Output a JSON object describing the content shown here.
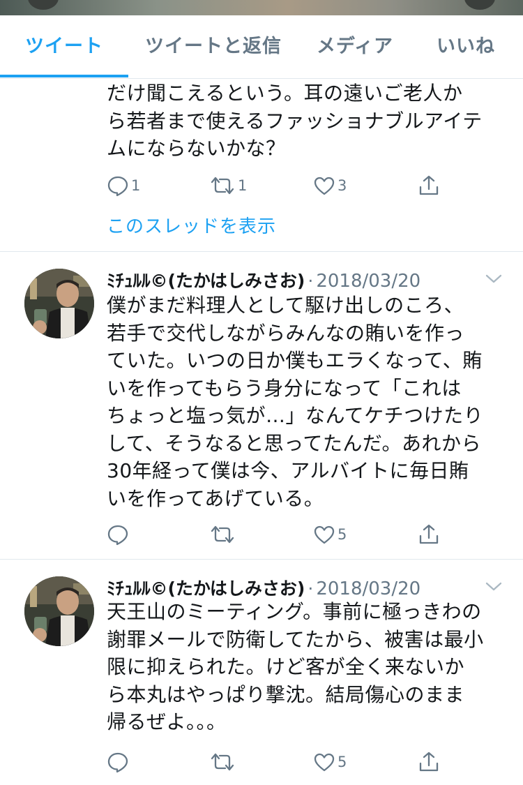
{
  "tabs": [
    {
      "label": "ツイート",
      "active": true
    },
    {
      "label": "ツイートと返信",
      "active": false
    },
    {
      "label": "メディア",
      "active": false
    },
    {
      "label": "いいね",
      "active": false
    }
  ],
  "partial_tweet": {
    "lines": [
      "だけ聞こえるという。耳の遠いご老人か",
      "ら若者まで使えるファッショナブルアイテ",
      "ムにならないかな？"
    ],
    "reply_count": "1",
    "retweet_count": "1",
    "like_count": "3",
    "thread_link": "このスレッドを表示"
  },
  "tweets": [
    {
      "display_name": "ﾐﾁｭﾙﾙ©(たかはしみさお)",
      "date": "2018/03/20",
      "lines": [
        "僕がまだ料理人として駆け出しのころ、",
        "若手で交代しながらみんなの賄いを作っ",
        "ていた。いつの日か僕もエラくなって、賄",
        "いを作ってもらう身分になって「これは",
        "ちょっと塩っ気が…」なんてケチつけたり",
        "して、そうなると思ってたんだ。あれから",
        "30年経って僕は今、アルバイトに毎日賄",
        "いを作ってあげている。"
      ],
      "reply_count": "",
      "retweet_count": "",
      "like_count": "5"
    },
    {
      "display_name": "ﾐﾁｭﾙﾙ©(たかはしみさお)",
      "date": "2018/03/20",
      "lines": [
        "天王山のミーティング。事前に極っきわの",
        "謝罪メールで防衛してたから、被害は最小",
        "限に抑えられた。けど客が全く来ないか",
        "ら本丸はやっぱり撃沈。結局傷心のまま",
        "帰るぜよ。。。"
      ],
      "reply_count": "",
      "retweet_count": "",
      "like_count": "5"
    }
  ],
  "colors": {
    "accent": "#1da1f2",
    "secondary_text": "#657786",
    "divider": "#e1e8ed"
  }
}
